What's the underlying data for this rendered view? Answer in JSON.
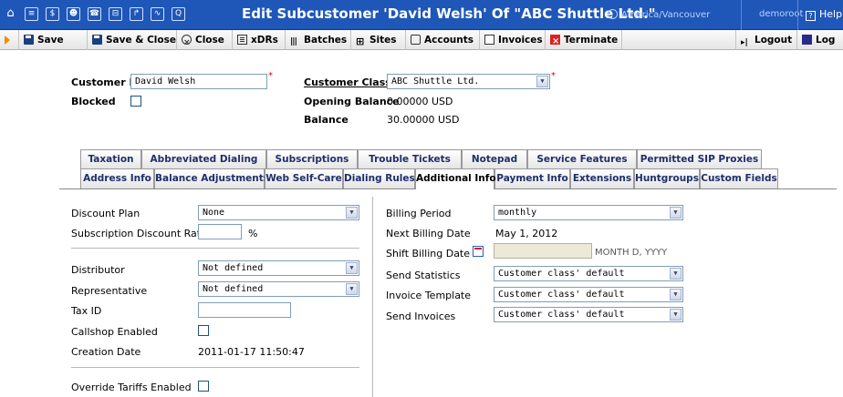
{
  "header": {
    "title": "Edit Subcustomer 'David Welsh' Of \"ABC Shuttle Ltd.\"",
    "timezone": "America/Vancouver",
    "user": "demoroot",
    "help": "Help"
  },
  "toolbar": {
    "save": "Save",
    "save_close": "Save & Close",
    "close": "Close",
    "xdrs": "xDRs",
    "batches": "Batches",
    "sites": "Sites",
    "accounts": "Accounts",
    "invoices": "Invoices",
    "terminate": "Terminate",
    "logout": "Logout",
    "log": "Log"
  },
  "customer": {
    "id_label": "Customer ID",
    "id_value": "David Welsh",
    "blocked_label": "Blocked",
    "class_label": "Customer Class",
    "class_value": "ABC Shuttle Ltd.",
    "opening_balance_label": "Opening Balance",
    "opening_balance_value": "0.00000 USD",
    "balance_label": "Balance",
    "balance_value": "30.00000 USD"
  },
  "tabs_row1": [
    "Taxation",
    "Abbreviated Dialing",
    "Subscriptions",
    "Trouble Tickets",
    "Notepad",
    "Service Features",
    "Permitted SIP Proxies"
  ],
  "tabs_row2": [
    "Address Info",
    "Balance Adjustments",
    "Web Self-Care",
    "Dialing Rules",
    "Additional Info",
    "Payment Info",
    "Extensions",
    "Huntgroups",
    "Custom Fields"
  ],
  "left": {
    "discount_plan_label": "Discount Plan",
    "discount_plan_value": "None",
    "sub_discount_label": "Subscription Discount Rate",
    "sub_discount_value": "",
    "percent": "%",
    "distributor_label": "Distributor",
    "distributor_value": "Not defined",
    "representative_label": "Representative",
    "representative_value": "Not defined",
    "tax_id_label": "Tax ID",
    "tax_id_value": "",
    "callshop_label": "Callshop Enabled",
    "creation_label": "Creation Date",
    "creation_value": "2011-01-17 11:50:47",
    "override_label": "Override Tariffs Enabled"
  },
  "right": {
    "billing_period_label": "Billing Period",
    "billing_period_value": "monthly",
    "next_billing_label": "Next Billing Date",
    "next_billing_value": "May 1, 2012",
    "shift_label": "Shift Billing Date To",
    "shift_value": "",
    "shift_hint": "MONTH D, YYYY",
    "send_stats_label": "Send Statistics",
    "send_stats_value": "Customer class' default",
    "invoice_template_label": "Invoice Template",
    "invoice_template_value": "Customer class' default",
    "send_invoices_label": "Send Invoices",
    "send_invoices_value": "Customer class' default"
  }
}
